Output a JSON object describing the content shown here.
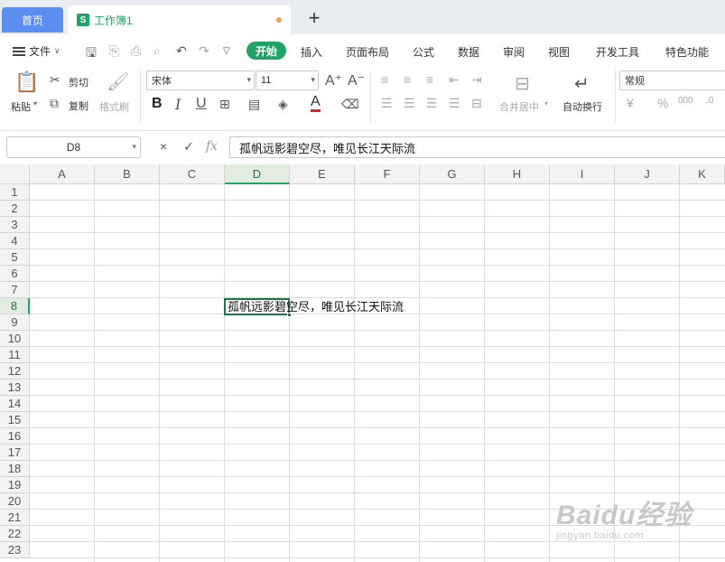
{
  "tabs": {
    "home": "首页",
    "doc_icon": "S",
    "doc_title": "工作簿1",
    "add": "+"
  },
  "menu": {
    "file": "文件",
    "start": "开始",
    "items": [
      "插入",
      "页面布局",
      "公式",
      "数据",
      "审阅",
      "视图",
      "开发工具",
      "特色功能"
    ]
  },
  "ribbon": {
    "paste": "粘贴",
    "cut": "剪切",
    "copy": "复制",
    "format_painter": "格式刷",
    "font_name": "宋体",
    "font_size": "11",
    "bold": "B",
    "italic": "I",
    "underline": "U",
    "font_color_letter": "A",
    "merge_center": "合并居中",
    "wrap_text": "自动换行",
    "number_format": "常规",
    "currency": "¥",
    "percent": "%",
    "decimal": "000"
  },
  "formula_bar": {
    "name_box": "D8",
    "cancel": "×",
    "confirm": "✓",
    "fx": "fx",
    "content": "孤帆远影碧空尽，唯见长江天际流"
  },
  "grid": {
    "columns": [
      "A",
      "B",
      "C",
      "D",
      "E",
      "F",
      "G",
      "H",
      "I",
      "J",
      "K"
    ],
    "rows": [
      "1",
      "2",
      "3",
      "4",
      "5",
      "6",
      "7",
      "8",
      "9",
      "10",
      "11",
      "12",
      "13",
      "14",
      "15",
      "16",
      "17",
      "18",
      "19",
      "20",
      "21",
      "22",
      "23"
    ],
    "active_col": "D",
    "active_row": "8",
    "cell_text": "孤帆远影碧空尽，唯见长江天际流"
  },
  "watermark": {
    "logo": "Baidu经验",
    "url": "jingyan.baidu.com"
  },
  "colors": {
    "accent": "#21a366",
    "home_tab": "#5b8ef0",
    "tab_bg": "#e9ecf1"
  }
}
